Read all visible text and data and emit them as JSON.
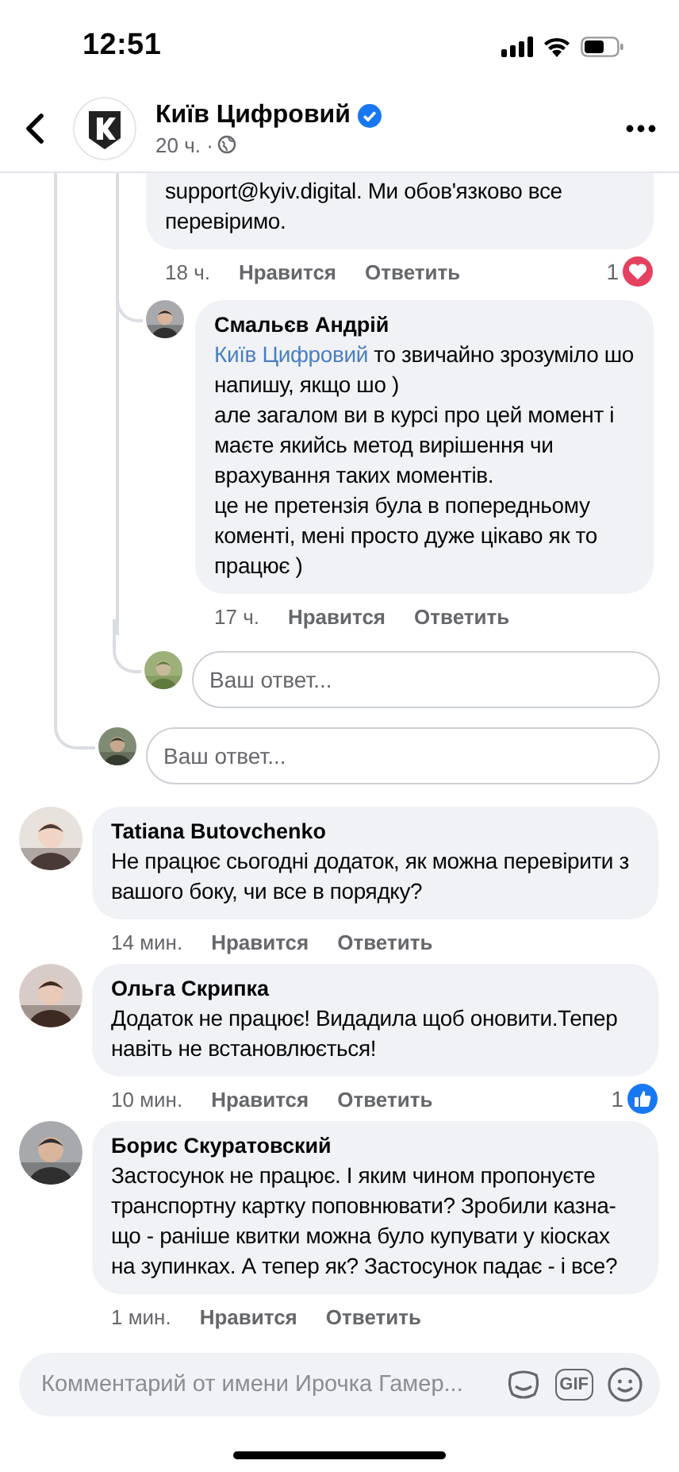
{
  "status_bar": {
    "time": "12:51"
  },
  "header": {
    "title": "Київ Цифровий",
    "verified": true,
    "meta": "20 ч. ·"
  },
  "thread": {
    "comment": {
      "text": "support@kyiv.digital. Ми обов'язково все перевіримо.",
      "time": "18 ч.",
      "like": "Нравится",
      "reply": "Ответить",
      "reactions": {
        "count": "1",
        "kind": "love"
      }
    },
    "replies": [
      {
        "author": "Смальєв Андрій",
        "mention": "Київ Цифровий",
        "text": "то звичайно зрозуміло шо напишу, якщо шо )\nале загалом ви в курсі про цей момент і маєте якийсь метод вирішення чи врахування таких моментів.\nце не претензія була в попередньому коменті, мені просто дуже цікаво як то працює )",
        "time": "17 ч.",
        "like": "Нравится",
        "reply": "Ответить"
      }
    ],
    "reply_field": {
      "placeholder": "Ваш ответ..."
    }
  },
  "reply_field": {
    "placeholder": "Ваш ответ..."
  },
  "comments": [
    {
      "author": "Tatiana Butovchenko",
      "text": "Не працює сьогодні додаток, як можна перевірити з вашого боку, чи все в порядку?",
      "time": "14 мин.",
      "like": "Нравится",
      "reply": "Ответить"
    },
    {
      "author": "Ольга Скрипка",
      "text": "Додаток не працює! Видадила щоб оновити.Тепер навіть не встановлюється!",
      "time": "10 мин.",
      "like": "Нравится",
      "reply": "Ответить",
      "reactions": {
        "count": "1",
        "kind": "like"
      }
    },
    {
      "author": "Борис Скуратовский",
      "text": "Застосунок не працює. І яким чином пропонуєте транспортну картку поповнювати? Зробили казна-що - раніше квитки можна було купувати у кіосках на зупинках. А тепер як? Застосунок падає - і все?",
      "time": "1 мин.",
      "like": "Нравится",
      "reply": "Ответить"
    }
  ],
  "composer": {
    "placeholder": "Комментарий от имени Ирочка Гамер...",
    "gif_label": "GIF"
  }
}
